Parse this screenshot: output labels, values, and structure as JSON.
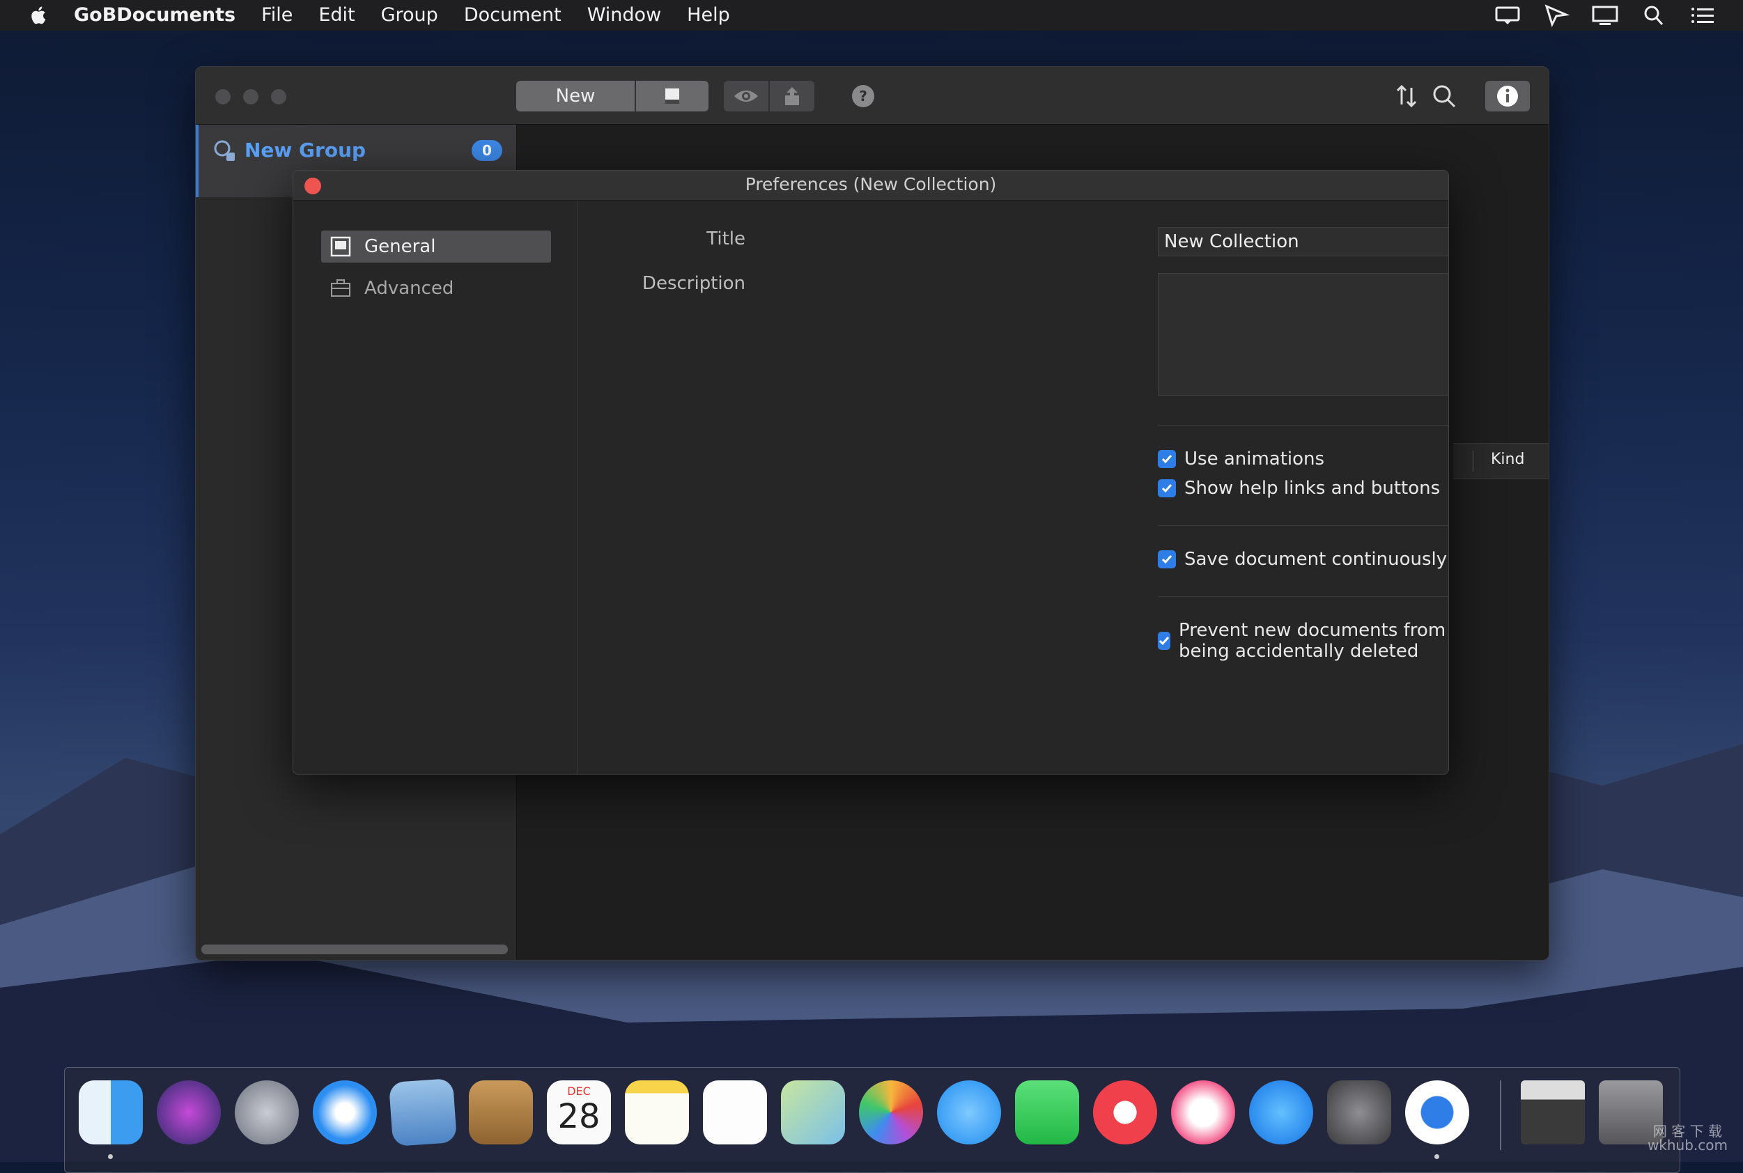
{
  "menubar": {
    "app_name": "GoBDocuments",
    "items": [
      "File",
      "Edit",
      "Group",
      "Document",
      "Window",
      "Help"
    ],
    "status_icons": [
      "notification-icon",
      "airplay-icon",
      "display-icon",
      "spotlight-icon",
      "control-list-icon"
    ]
  },
  "window": {
    "toolbar": {
      "new_label": "New"
    },
    "sidebar": {
      "group_label": "New Group",
      "group_count": "0"
    },
    "content": {
      "column_header": "Kind"
    }
  },
  "preferences": {
    "title": "Preferences (New Collection)",
    "tabs": [
      {
        "label": "General",
        "selected": true
      },
      {
        "label": "Advanced",
        "selected": false
      }
    ],
    "title_label": "Title",
    "title_value": "New Collection",
    "description_label": "Description",
    "description_value": "",
    "checkboxes": [
      {
        "label": "Use animations",
        "checked": true
      },
      {
        "label": "Show help links and buttons",
        "checked": true
      },
      {
        "label": "Save document continuously",
        "checked": true
      },
      {
        "label": "Prevent new documents from being accidentally deleted",
        "checked": true
      }
    ]
  },
  "dock": {
    "calendar_month": "DEC",
    "calendar_day": "28",
    "apps": [
      "finder-icon",
      "siri-icon",
      "launchpad-icon",
      "safari-icon",
      "mail-icon",
      "contacts-icon",
      "calendar-icon",
      "notes-icon",
      "reminders-icon",
      "maps-icon",
      "photos-icon",
      "messages-icon",
      "facetime-icon",
      "news-icon",
      "music-icon",
      "app-store-icon",
      "system-preferences-icon",
      "gobdocuments-icon"
    ],
    "extras": [
      "downloads-stack-icon",
      "trash-icon"
    ]
  },
  "watermark": {
    "line1": "网 客 下 载",
    "line2": "wkhub.com"
  },
  "colors": {
    "accent": "#2f7ee8",
    "sidebar_selected_text": "#5aa0f5",
    "close_red": "#ee5450"
  }
}
